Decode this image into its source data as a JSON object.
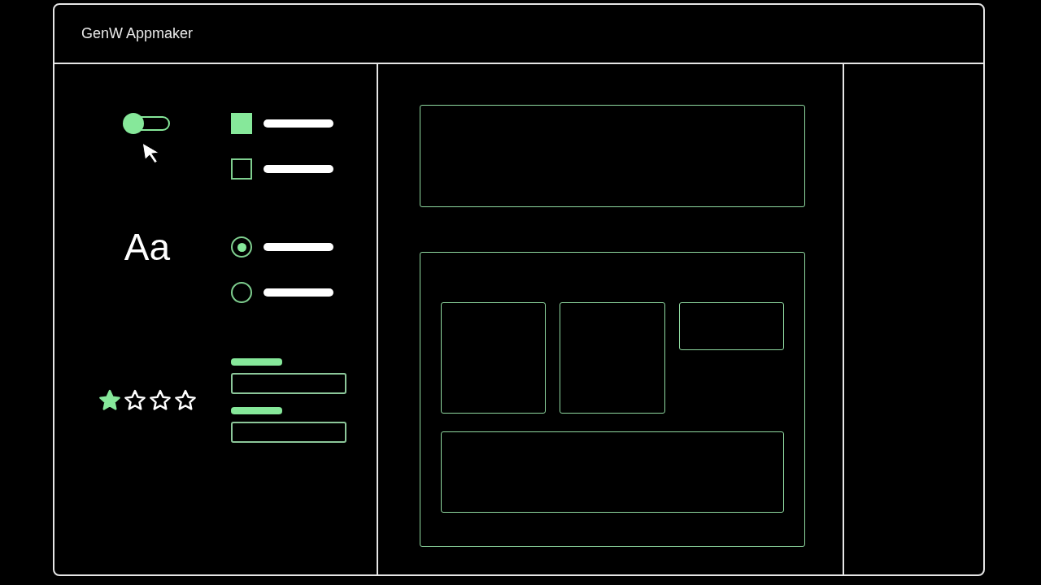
{
  "window": {
    "title": "GenW Appmaker"
  },
  "toggle": {
    "on": false
  },
  "checkboxes": [
    {
      "checked": true
    },
    {
      "checked": false
    }
  ],
  "type_sample": "Aa",
  "radios": [
    {
      "selected": true
    },
    {
      "selected": false
    }
  ],
  "rating": {
    "stars": 1
  },
  "fields": [
    {
      "kind": "input"
    },
    {
      "kind": "input"
    }
  ]
}
